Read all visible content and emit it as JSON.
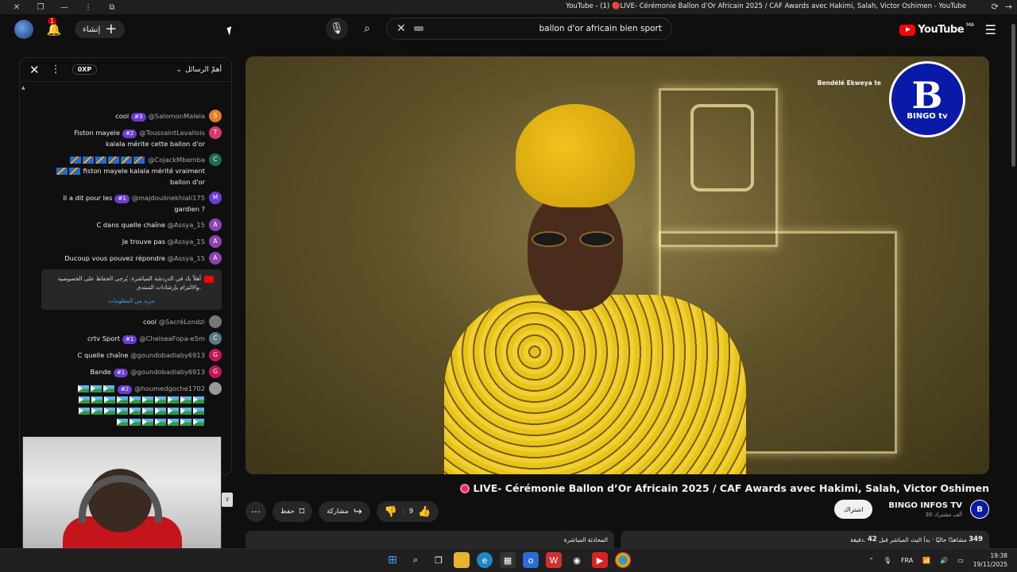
{
  "window": {
    "title": "YouTube - (1) 🔴LIVE- Cérémonie Ballon d’Or Africain 2025 / CAF Awards avec Hakimi, Salah, Victor Oshimen - YouTube"
  },
  "header": {
    "notifications_count": "1",
    "create_label": "إنشاء",
    "search_query": "ballon d'or africain bien sport",
    "logo_text": "YouTube",
    "logo_region": "MA"
  },
  "chat": {
    "xp_label": "0XP",
    "sort_label": "أهمّ الرسائل",
    "messages": [
      {
        "author": "@SalomonMalela",
        "rank": "#3",
        "text": "cool",
        "initial": "S",
        "color": "#e67e22"
      },
      {
        "author": "@ToussaintLevallois",
        "rank": "#2",
        "text": "Fiston mayele",
        "text2": "kalala mérite cette ballon d'or",
        "initial": "T",
        "color": "#d63a6a"
      },
      {
        "author": "@CojackMbemba",
        "text": "fiston mayele kalala mérité vraiment",
        "text2": "ballon d'or",
        "initial": "C",
        "color": "#1f6d4e"
      },
      {
        "author": "@majdoulinekhiali175",
        "rank": "#1",
        "text": "Il a dit pour les",
        "text2": "gardien ?",
        "initial": "M",
        "color": "#6c3bd4"
      },
      {
        "author": "@Assya_15",
        "text": "C dans quelle chaîne",
        "initial": "A",
        "color": "#8e44ad"
      },
      {
        "author": "@Assya_15",
        "text": "Je trouve pas",
        "initial": "A",
        "color": "#8e44ad"
      },
      {
        "author": "@Assya_15",
        "text": "Ducoup vous pouvez répondre",
        "initial": "A",
        "color": "#8e44ad"
      },
      {
        "author": "@SacréLondzi",
        "text": "cool",
        "initial": "",
        "color": "#777"
      },
      {
        "author": "@ChelseaFopa-e5m",
        "rank": "#1",
        "text": "crtv Sport",
        "initial": "C",
        "color": "#5a7a8a"
      },
      {
        "author": "@goundobadiaby6913",
        "text": "C quelle chaîne",
        "initial": "G",
        "color": "#c2185b"
      },
      {
        "author": "@goundobadiaby6913",
        "rank": "#1",
        "text": "Bande",
        "initial": "G",
        "color": "#c2185b"
      },
      {
        "author": "@houmedgoche1702",
        "rank": "#2",
        "text": "",
        "initial": "",
        "color": "#999"
      }
    ],
    "notice_text": "أهلاً بك في الدردشة المباشرة. يُرجى الحفاظ على الخصوصية والالتزام بإرشادات المنتدى.",
    "notice_link": "مزيد من المعلومات"
  },
  "video": {
    "title": "LIVE- Cérémonie Ballon d’Or Africain 2025 / CAF Awards avec Hakimi, Salah, Victor Oshimen",
    "channel_name": "BINGO INFOS TV",
    "channel_subs": "30 ألف مشترك",
    "subscribe_label": "اشتراك",
    "likes": "9",
    "share_label": "مشاركة",
    "save_label": "حفظ",
    "live_chat_tab": "المحادثة المباشرة",
    "viewers_count": "349",
    "viewers_text": "مشاهدًا حاليًا · بدأ البث المباشر قبل",
    "minutes_value": "42",
    "minutes_unit": "دقيقة.",
    "watermark_main": "B",
    "watermark_sub": "BINGO tv",
    "sponsor_text": "Bendélé Ekweya te"
  },
  "taskbar": {
    "lang": "FRA",
    "time": "19:38",
    "date": "19/11/2025"
  }
}
